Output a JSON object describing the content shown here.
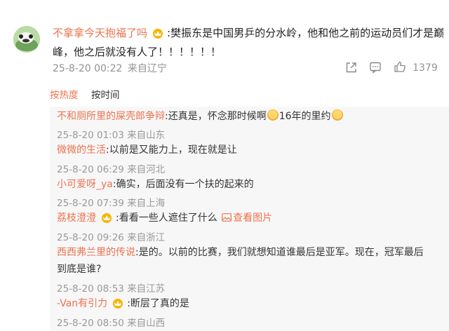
{
  "main_comment": {
    "username": "不拿拿今天抱福了吗",
    "text_line1": ":樊振东是中国男乒的分水岭，他和他之前的运动员们才是巅",
    "text_line2": "峰，他之后就没有人了！！！！！！",
    "timestamp": "25-8-20 00:22",
    "location": "来自辽宁",
    "like_count": "1379"
  },
  "sort_tabs": {
    "by_hot": "按热度",
    "by_time": "按时间"
  },
  "replies": [
    {
      "username": "不和厕所里的屎壳郎争辩",
      "text": ":还真是，怀念那时候啊",
      "text_tail": "16年的里约",
      "timestamp": "25-8-20 01:03",
      "location": "来自山东"
    },
    {
      "username": "微微的生活",
      "text": ":以前是又能力上，现在就是让",
      "timestamp": "25-8-20 06:29",
      "location": "来自河北"
    },
    {
      "username": "小可爱呀_ya",
      "text": ":确实，后面没有一个扶的起来的",
      "timestamp": "25-8-20 07:39",
      "location": "来自上海"
    },
    {
      "username": "荔枝澄澄",
      "text": ":看看一些人遮住了什么",
      "link": "查看图片",
      "timestamp": "25-8-20 09:26",
      "location": "来自浙江"
    },
    {
      "username": "西西弗兰里的传说",
      "text": ":是的。以前的比赛，我们就想知道谁最后是亚军。现在，冠军最后",
      "text_line2": "到底是谁?",
      "timestamp": "25-8-20 08:53",
      "location": "来自江苏"
    },
    {
      "username": "-Van有引力",
      "text": ":断层了真的是",
      "timestamp": "25-8-20 08:50",
      "location": "来自山西"
    }
  ],
  "colors": {
    "username": "#eb7350",
    "meta": "#939393",
    "reply_bg": "#f7f7f7",
    "active_tab": "#eb7350"
  },
  "icons": [
    "share-icon",
    "comment-icon",
    "like-icon",
    "vip-crown-icon",
    "crying-emoji-icon",
    "image-icon"
  ]
}
